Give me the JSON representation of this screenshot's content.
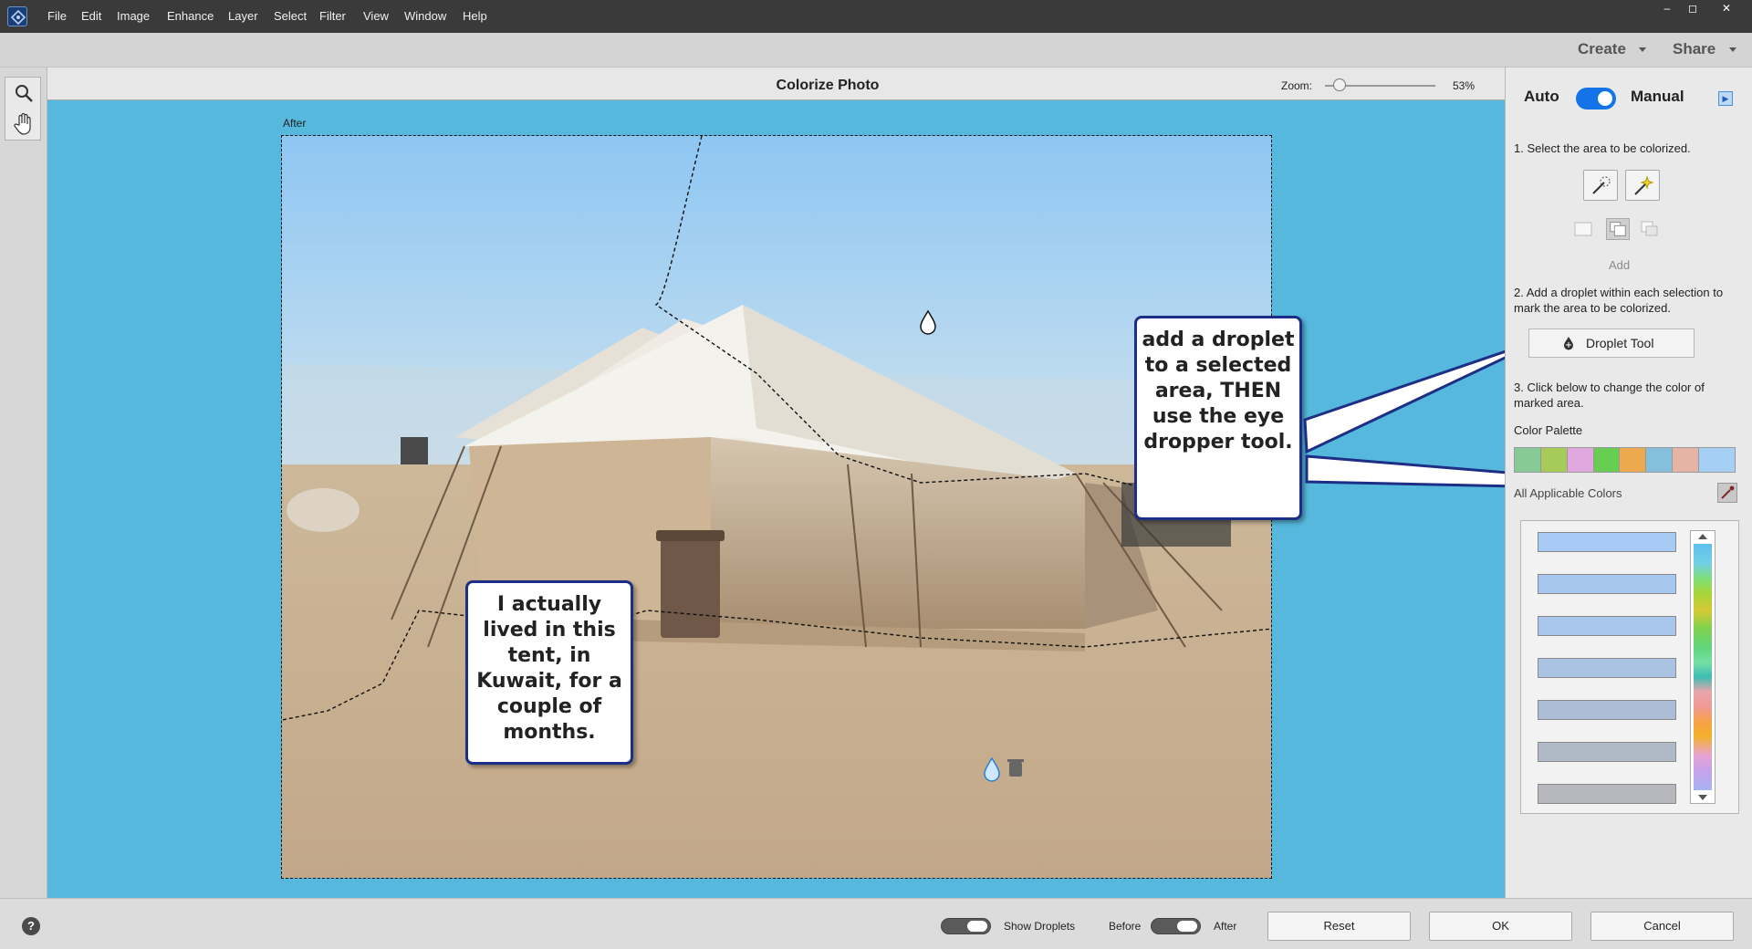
{
  "menubar": {
    "items": [
      "File",
      "Edit",
      "Image",
      "Enhance",
      "Layer",
      "Select",
      "Filter",
      "View",
      "Window",
      "Help"
    ],
    "window_controls": [
      "–",
      "◻",
      "✕"
    ]
  },
  "subbar": {
    "create": "Create",
    "share": "Share"
  },
  "toolbox": {
    "tools": [
      "search-icon",
      "hand-icon"
    ]
  },
  "document": {
    "title": "Colorize Photo",
    "zoom_label": "Zoom:",
    "zoom_value": "53%",
    "zoom_level": 0.53,
    "view_label": "After"
  },
  "callouts": {
    "tent": "I actually lived in this tent, in Kuwait, for a couple of months.",
    "droplet": "add a droplet to a selected area, THEN use the eye dropper tool."
  },
  "panel": {
    "auto_label": "Auto",
    "manual_label": "Manual",
    "mode_manual_on": true,
    "step1": "1. Select the area to be colorized.",
    "add_label": "Add",
    "step2": "2. Add a droplet within each selection to mark the area to be colorized.",
    "droplet_button": "Droplet Tool",
    "step3": "3. Click below to change the color of marked area.",
    "palette_label": "Color Palette",
    "palette_colors": [
      "#88c998",
      "#a6cb58",
      "#e1a8e0",
      "#66cf53",
      "#eda94d",
      "#84c0dc",
      "#e5b4a4"
    ],
    "selected_color": "#a5cff5",
    "all_colors_label": "All Applicable Colors",
    "applicable_colors": [
      "#a7cbf5",
      "#a6c8ef",
      "#a9c7ec",
      "#abc3e3",
      "#acbcd5",
      "#b0bac7",
      "#b6b8bd"
    ]
  },
  "bottombar": {
    "show_droplets": "Show Droplets",
    "before": "Before",
    "after": "After",
    "reset": "Reset",
    "ok": "OK",
    "cancel": "Cancel",
    "help": "?"
  }
}
